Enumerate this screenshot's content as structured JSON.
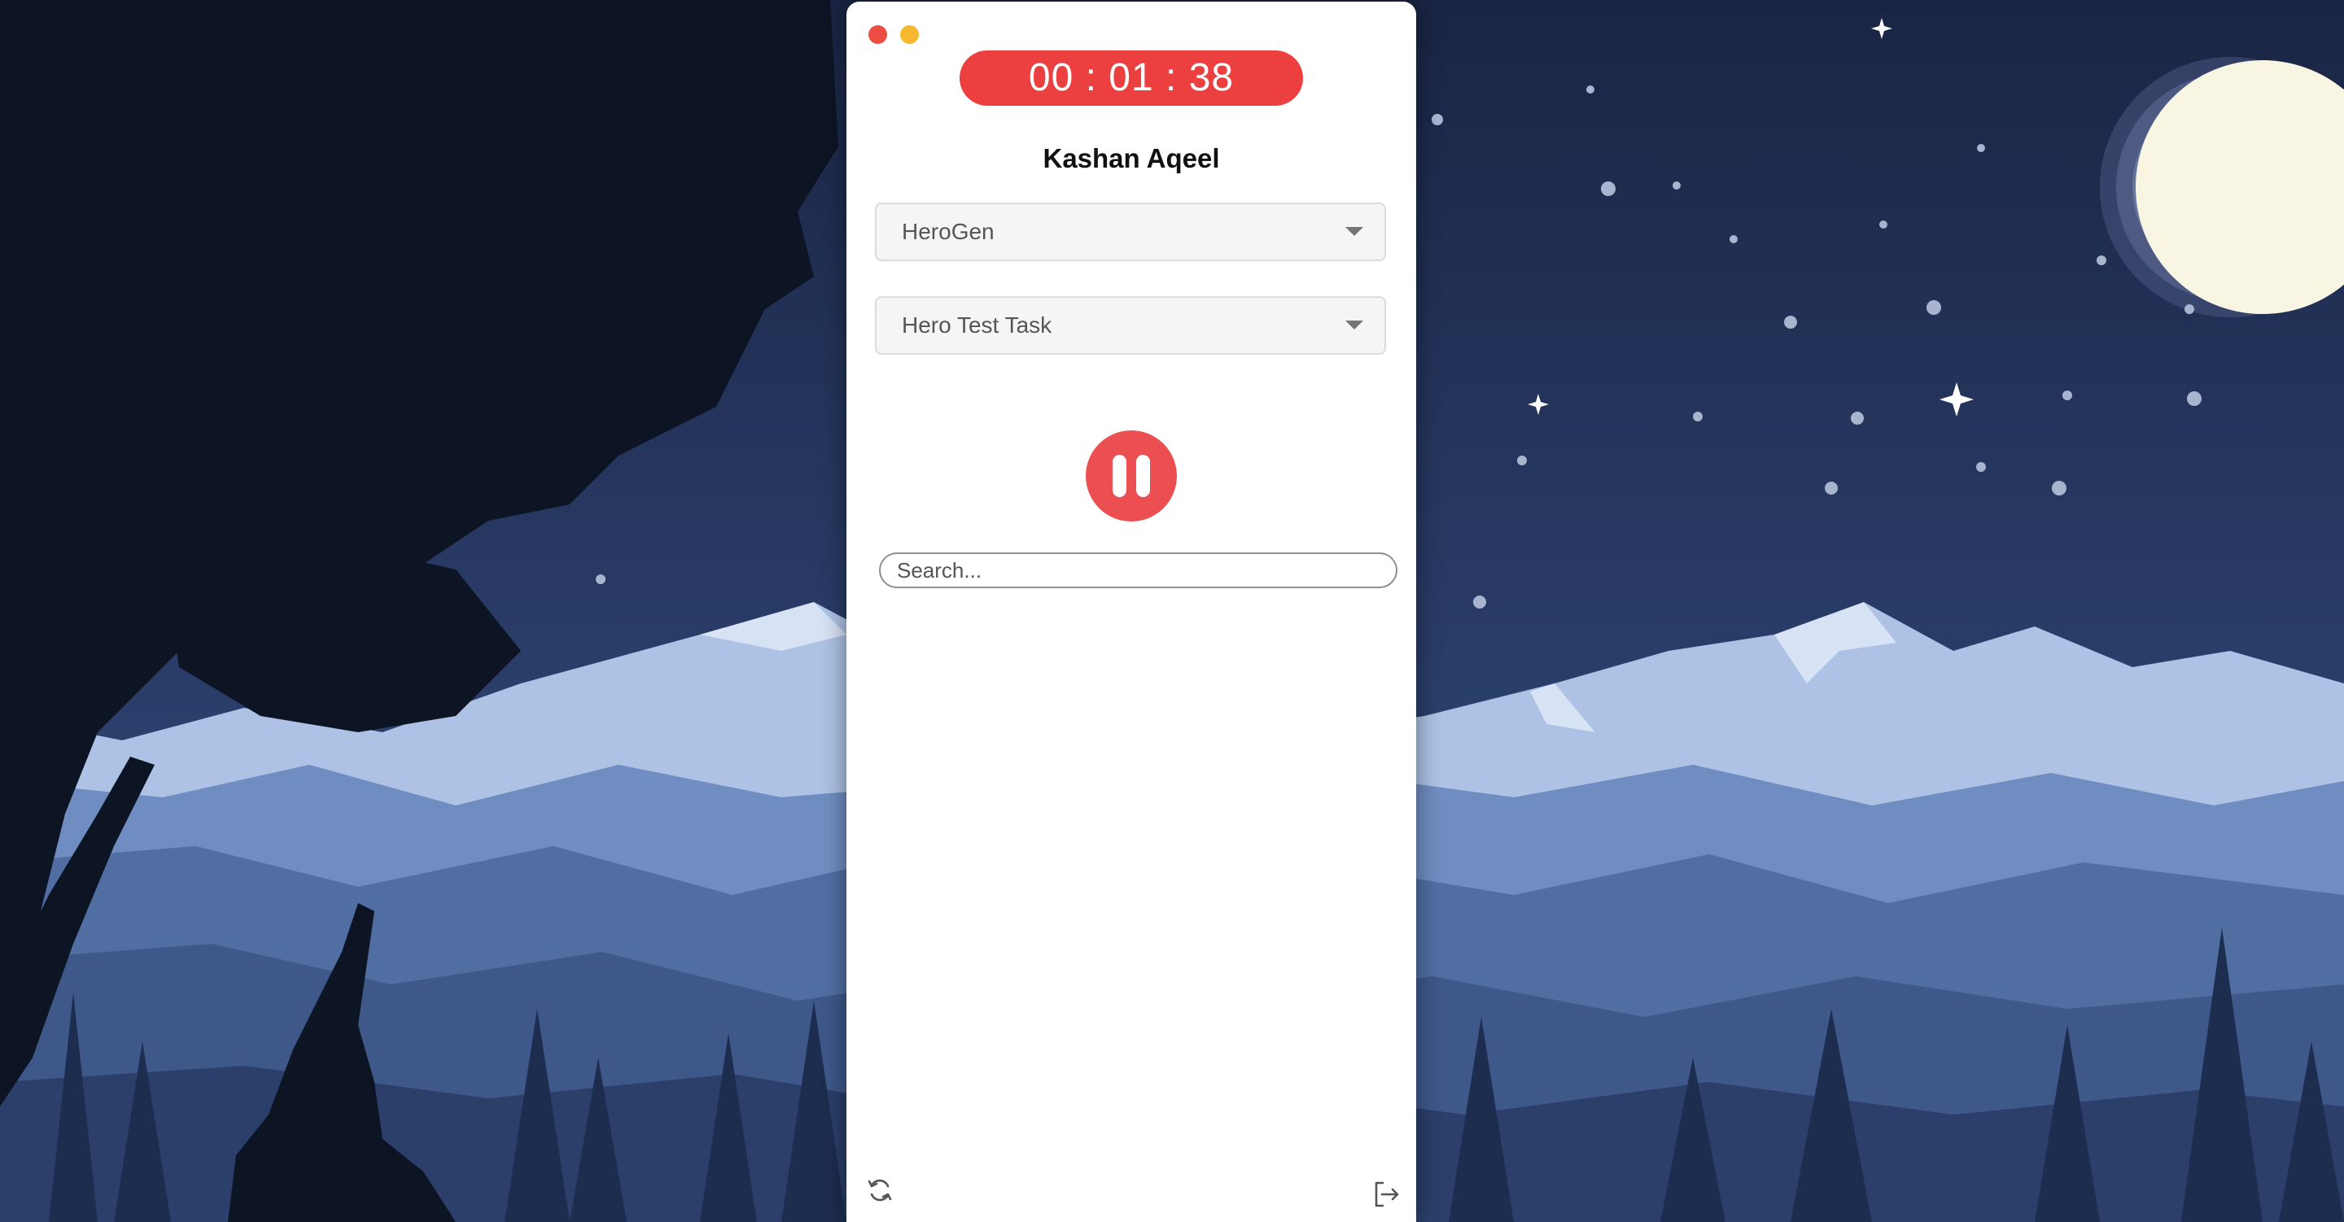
{
  "timer": {
    "display": "00 : 01 : 38"
  },
  "user": {
    "name": "Kashan Aqeel"
  },
  "project_select": {
    "selected": "HeroGen"
  },
  "task_select": {
    "selected": "Hero Test Task"
  },
  "search": {
    "placeholder": "Search...",
    "value": ""
  },
  "icons": {
    "pause": "pause-icon",
    "refresh": "refresh-icon",
    "logout": "logout-icon",
    "dropdown": "chevron-down-icon"
  },
  "colors": {
    "timer_bg": "#ec4040",
    "pause_bg": "#ec4f52",
    "close_dot": "#ee4d45",
    "minimize_dot": "#f6b82f"
  }
}
